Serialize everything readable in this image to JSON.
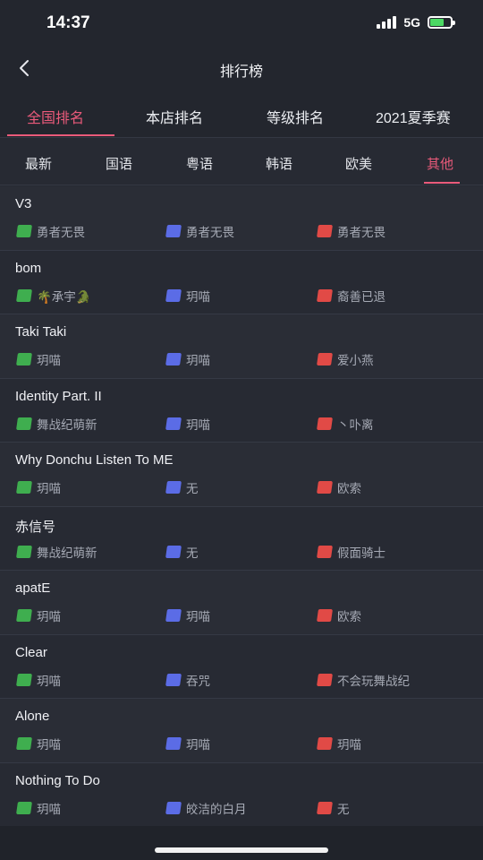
{
  "status": {
    "time": "14:37",
    "network": "5G"
  },
  "header": {
    "title": "排行榜"
  },
  "tabs": [
    {
      "label": "全国排名",
      "active": true
    },
    {
      "label": "本店排名",
      "active": false
    },
    {
      "label": "等级排名",
      "active": false
    },
    {
      "label": "2021夏季赛",
      "active": false
    }
  ],
  "subtabs": [
    {
      "label": "最新",
      "active": false
    },
    {
      "label": "国语",
      "active": false
    },
    {
      "label": "粤语",
      "active": false
    },
    {
      "label": "韩语",
      "active": false
    },
    {
      "label": "欧美",
      "active": false
    },
    {
      "label": "其他",
      "active": true
    }
  ],
  "colors": {
    "accent": "#ea5a7a",
    "green_badge": "#3fae4f",
    "blue_badge": "#5b6ce6",
    "red_badge": "#e14a46"
  },
  "songs": [
    {
      "title": "V3",
      "players": [
        "勇者无畏",
        "勇者无畏",
        "勇者无畏"
      ]
    },
    {
      "title": "bom",
      "players": [
        "🌴承宇🐊",
        "玥喵",
        "裔善已退"
      ]
    },
    {
      "title": "Taki Taki",
      "players": [
        "玥喵",
        "玥喵",
        "爱小燕"
      ]
    },
    {
      "title": "Identity Part. II",
      "players": [
        "舞战纪萌新",
        "玥喵",
        "丶卟离"
      ]
    },
    {
      "title": "Why Donchu Listen To ME",
      "players": [
        "玥喵",
        "无",
        "欧索"
      ]
    },
    {
      "title": "赤信号",
      "players": [
        "舞战纪萌新",
        "无",
        "假面骑士"
      ]
    },
    {
      "title": "apatE",
      "players": [
        "玥喵",
        "玥喵",
        "欧索"
      ]
    },
    {
      "title": "Clear",
      "players": [
        "玥喵",
        "吞咒",
        "不会玩舞战纪"
      ]
    },
    {
      "title": "Alone",
      "players": [
        "玥喵",
        "玥喵",
        "玥喵"
      ]
    },
    {
      "title": "Nothing To Do",
      "players": [
        "玥喵",
        "皎洁的白月",
        "无"
      ]
    }
  ]
}
